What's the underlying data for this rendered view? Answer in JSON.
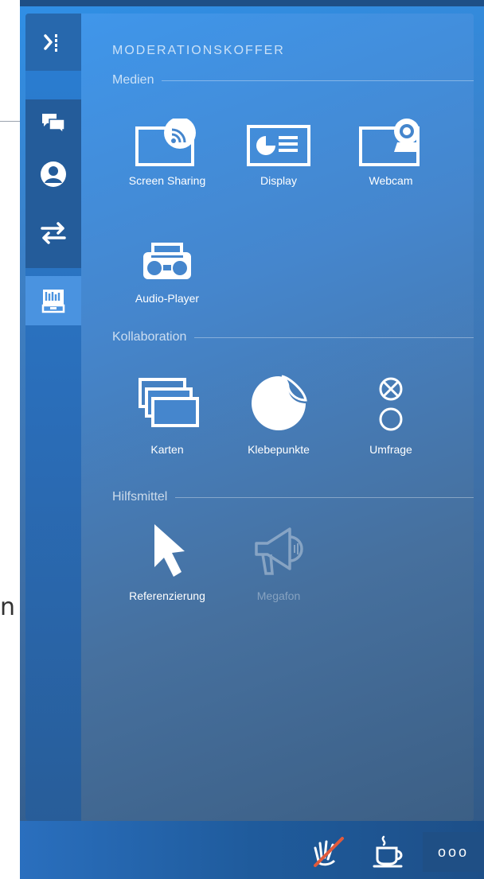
{
  "panel": {
    "title": "MODERATIONSKOFFER"
  },
  "sections": {
    "medien": "Medien",
    "kollaboration": "Kollaboration",
    "hilfsmittel": "Hilfsmittel"
  },
  "tools": {
    "screen_sharing": "Screen Sharing",
    "display": "Display",
    "webcam": "Webcam",
    "audio_player": "Audio-Player",
    "karten": "Karten",
    "klebepunkte": "Klebepunkte",
    "umfrage": "Umfrage",
    "referenzierung": "Referenzierung",
    "megafon": "Megafon"
  },
  "bottom_bar": {
    "more_label": "ooo"
  },
  "background": {
    "partial_letter": "n"
  },
  "colors": {
    "accent": "#3f97ec",
    "rail": "#2a6db8",
    "bottom_bar": "#1f5b9c"
  },
  "icons": {
    "rail": [
      "collapse-panel-icon",
      "chat-icon",
      "user-icon",
      "swap-icon",
      "toolbox-icon"
    ],
    "bottom": [
      "mute-hand-icon",
      "coffee-break-icon",
      "more-icon"
    ]
  }
}
